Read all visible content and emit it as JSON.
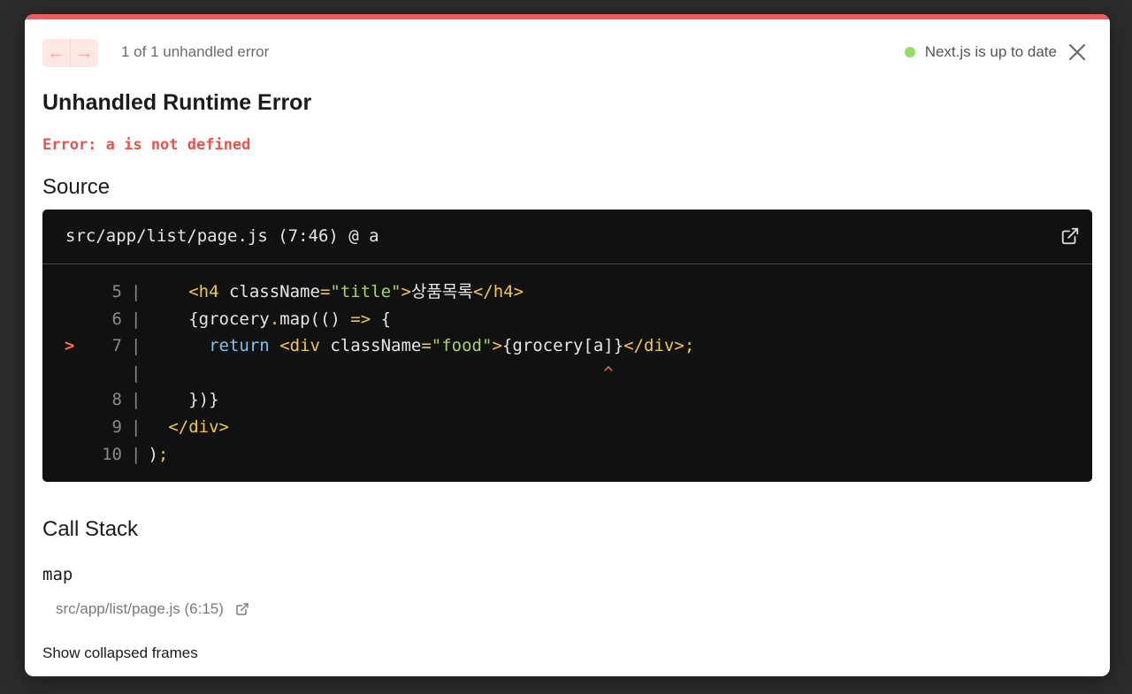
{
  "header": {
    "nav_prev_icon": "arrow-left-icon",
    "nav_next_icon": "arrow-right-icon",
    "error_count": "1 of 1 unhandled error",
    "status_text": "Next.js is up to date",
    "status_color": "#8ee05f",
    "close_icon": "close-icon"
  },
  "error": {
    "title": "Unhandled Runtime Error",
    "message": "Error: a is not defined",
    "accent_color": "#ef5b5b"
  },
  "source": {
    "heading": "Source",
    "file_ref": "src/app/list/page.js (7:46) @ a",
    "open_icon": "external-link-icon",
    "lines": [
      {
        "num": "5",
        "marker": "",
        "tokens": [
          [
            "text",
            "    "
          ],
          [
            "tag",
            "<h4 "
          ],
          [
            "attr",
            "className"
          ],
          [
            "eq",
            "="
          ],
          [
            "str",
            "\"title\""
          ],
          [
            "tag",
            ">"
          ],
          [
            "text",
            "상품목록"
          ],
          [
            "tag",
            "</h4>"
          ]
        ]
      },
      {
        "num": "6",
        "marker": "",
        "tokens": [
          [
            "text",
            "    {grocery"
          ],
          [
            "op",
            "."
          ],
          [
            "text",
            "map(() "
          ],
          [
            "op",
            "=>"
          ],
          [
            "text",
            " {"
          ]
        ]
      },
      {
        "num": "7",
        "marker": ">",
        "tokens": [
          [
            "text",
            "      "
          ],
          [
            "kw",
            "return"
          ],
          [
            "text",
            " "
          ],
          [
            "tag",
            "<div "
          ],
          [
            "attr",
            "className"
          ],
          [
            "eq",
            "="
          ],
          [
            "str",
            "\"food\""
          ],
          [
            "tag",
            ">"
          ],
          [
            "text",
            "{grocery[a]}"
          ],
          [
            "tag",
            "</div>"
          ],
          [
            "op",
            ";"
          ]
        ]
      },
      {
        "num": "",
        "marker": "",
        "tokens": [
          [
            "text",
            "                                             "
          ],
          [
            "caret",
            "^"
          ]
        ]
      },
      {
        "num": "8",
        "marker": "",
        "tokens": [
          [
            "text",
            "    })}"
          ]
        ]
      },
      {
        "num": "9",
        "marker": "",
        "tokens": [
          [
            "text",
            "  "
          ],
          [
            "tag",
            "</div>"
          ]
        ]
      },
      {
        "num": "10",
        "marker": "",
        "tokens": [
          [
            "text",
            ")"
          ],
          [
            "op",
            ";"
          ]
        ]
      }
    ]
  },
  "call_stack": {
    "heading": "Call Stack",
    "frames": [
      {
        "name": "map",
        "location": "src/app/list/page.js (6:15)"
      }
    ],
    "show_collapsed": "Show collapsed frames"
  }
}
